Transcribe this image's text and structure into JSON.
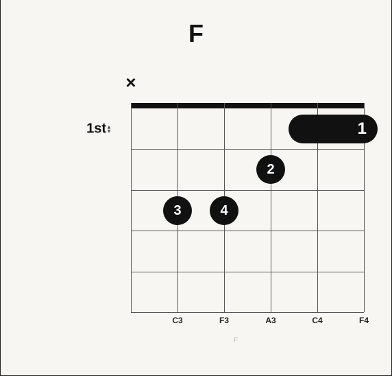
{
  "chord": {
    "name": "F",
    "starting_fret_label": "1st",
    "footer_label": "F"
  },
  "chart_data": {
    "type": "chord-diagram",
    "instrument": "guitar",
    "strings": 6,
    "frets_shown": 5,
    "starting_fret": 1,
    "string_states": [
      {
        "string": 6,
        "state": "muted",
        "symbol": "×"
      },
      {
        "string": 5,
        "state": "fretted"
      },
      {
        "string": 4,
        "state": "fretted"
      },
      {
        "string": 3,
        "state": "fretted"
      },
      {
        "string": 2,
        "state": "fretted"
      },
      {
        "string": 1,
        "state": "fretted"
      }
    ],
    "fingers": [
      {
        "finger": "1",
        "fret": 1,
        "from_string": 2,
        "to_string": 1,
        "barre": true
      },
      {
        "finger": "2",
        "fret": 2,
        "string": 3
      },
      {
        "finger": "3",
        "fret": 3,
        "string": 5
      },
      {
        "finger": "4",
        "fret": 3,
        "string": 4
      }
    ],
    "note_labels": [
      {
        "string": 5,
        "note": "C3"
      },
      {
        "string": 4,
        "note": "F3"
      },
      {
        "string": 3,
        "note": "A3"
      },
      {
        "string": 2,
        "note": "C4"
      },
      {
        "string": 1,
        "note": "F4"
      }
    ]
  }
}
